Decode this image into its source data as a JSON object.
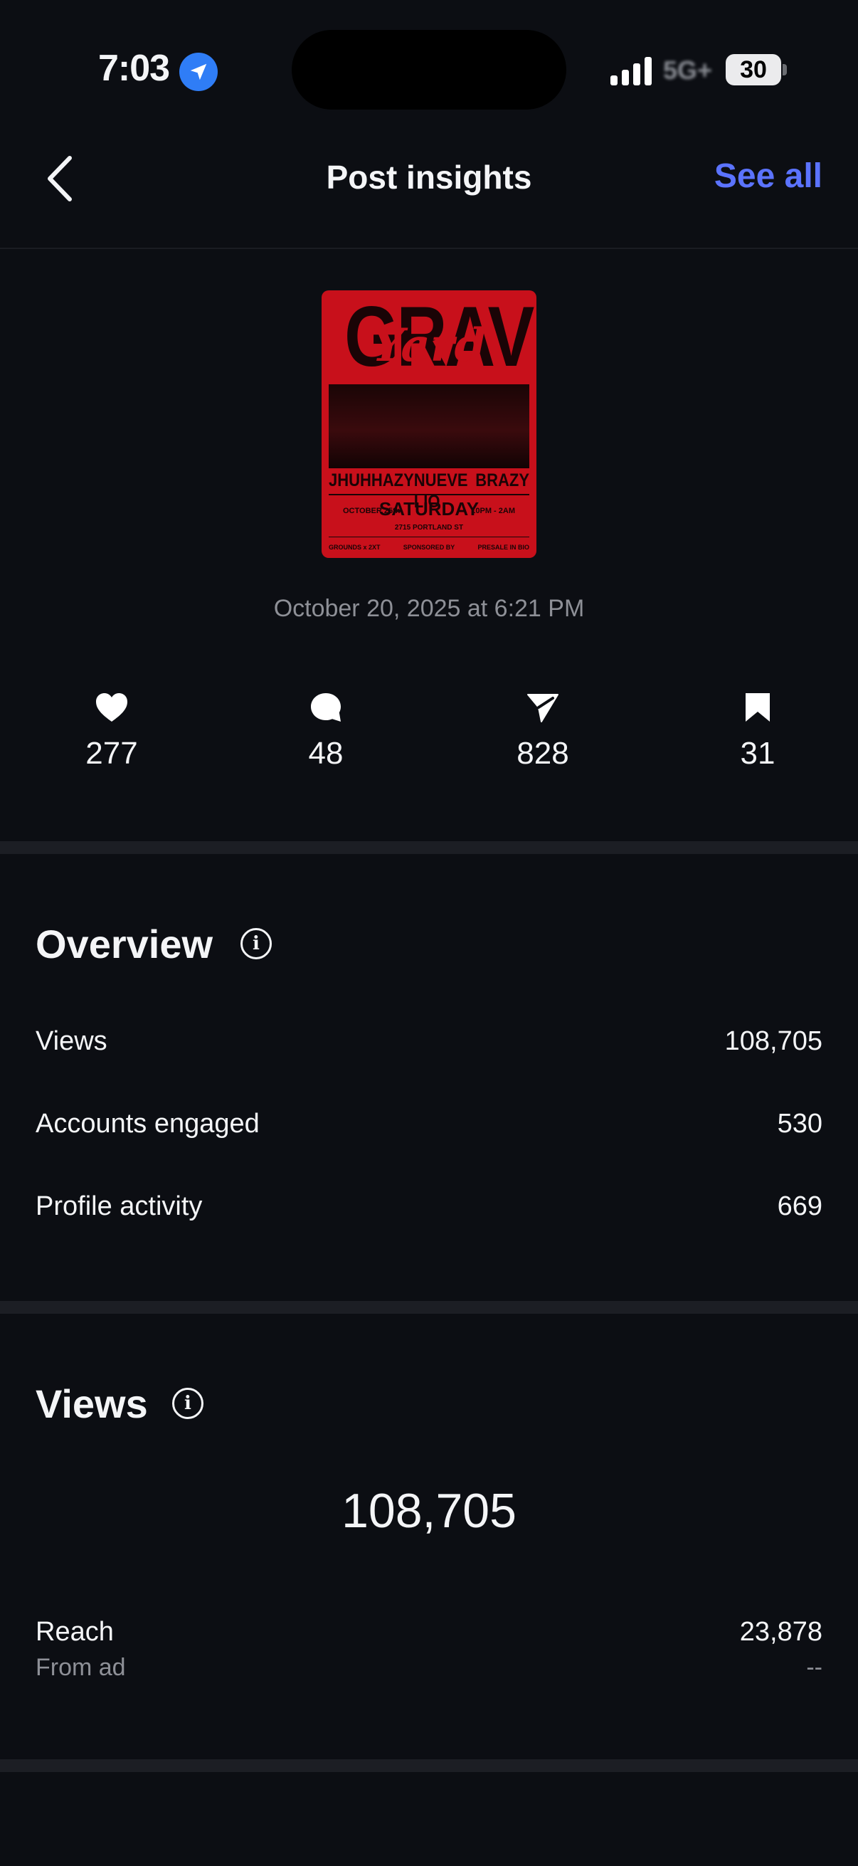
{
  "status": {
    "time": "7:03",
    "network": "5G+",
    "battery": "30"
  },
  "header": {
    "title": "Post insights",
    "see_all": "See all"
  },
  "post": {
    "date": "October 20, 2025 at 6:21 PM",
    "poster": {
      "headline": "GRAVE",
      "script": "Yard",
      "acts": [
        "JHUH",
        "HAZY",
        "NUEVE LIO",
        "BRAZY"
      ],
      "day": "SATURDAY",
      "left_info": "OCTOBER 25th",
      "right_info": "10PM - 2AM",
      "address": "2715 PORTLAND ST",
      "footer_left": "GROUNDS x 2XT",
      "footer_mid": "SPONSORED BY",
      "footer_right": "PRESALE IN BIO"
    }
  },
  "stats": [
    {
      "icon": "heart-icon",
      "value": "277"
    },
    {
      "icon": "comment-icon",
      "value": "48"
    },
    {
      "icon": "share-icon",
      "value": "828"
    },
    {
      "icon": "bookmark-icon",
      "value": "31"
    }
  ],
  "overview": {
    "title": "Overview",
    "rows": [
      {
        "label": "Views",
        "value": "108,705"
      },
      {
        "label": "Accounts engaged",
        "value": "530"
      },
      {
        "label": "Profile activity",
        "value": "669"
      }
    ]
  },
  "views": {
    "title": "Views",
    "total": "108,705",
    "reach_label": "Reach",
    "reach_value": "23,878",
    "from_ad_label": "From ad",
    "from_ad_value": "--"
  }
}
